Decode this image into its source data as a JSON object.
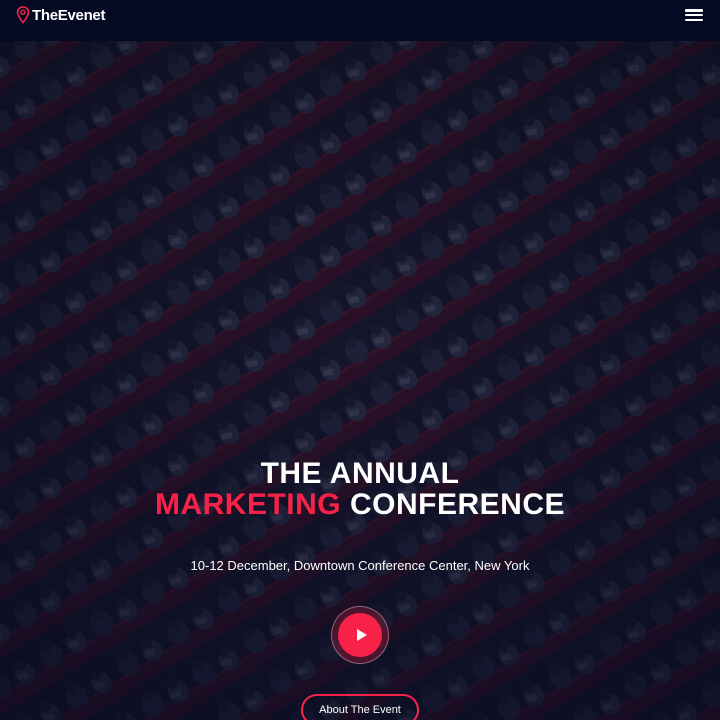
{
  "brand": {
    "prefix": "The",
    "name": "Evenet"
  },
  "hero": {
    "title_line1": "THE ANNUAL",
    "title_accent": "MARKETING",
    "title_rest": " CONFERENCE",
    "subtitle": "10-12 December, Downtown Conference Center, New York",
    "about_button": "About The Event"
  },
  "icons": {
    "logo": "map-pin-icon",
    "menu": "hamburger-menu-icon",
    "play": "play-icon"
  },
  "colors": {
    "accent": "#f82249",
    "nav_bg": "#050a23",
    "overlay": "#090c28"
  }
}
